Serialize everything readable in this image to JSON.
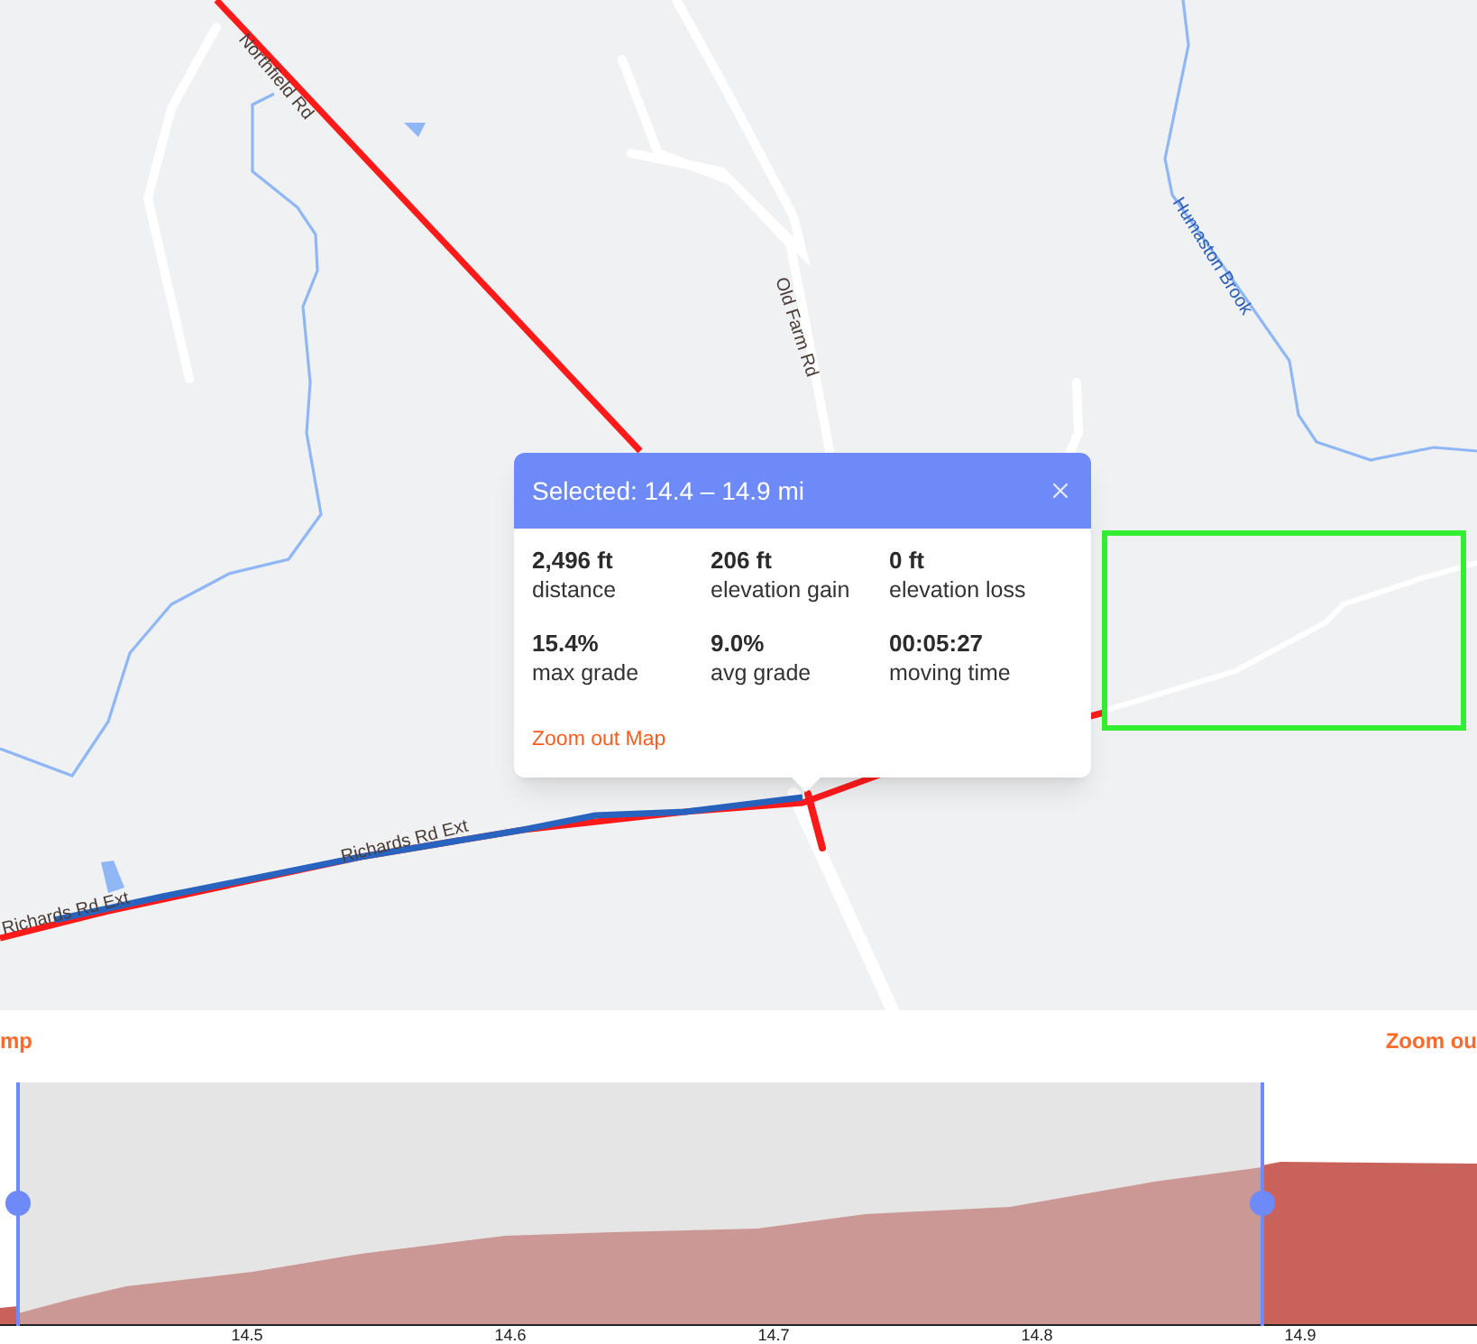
{
  "map": {
    "labels": [
      {
        "kind": "road",
        "text": "Northfield Rd"
      },
      {
        "kind": "road",
        "text": "Old Farm Rd"
      },
      {
        "kind": "water",
        "text": "Humaston Brook"
      },
      {
        "kind": "road",
        "text": "Richards Rd Ext"
      },
      {
        "kind": "road",
        "text": "Richards Rd Ext"
      }
    ]
  },
  "popup": {
    "title": "Selected: 14.4 – 14.9 mi",
    "stats": [
      {
        "value": "2,496 ft",
        "label": "distance"
      },
      {
        "value": "206 ft",
        "label": "elevation gain"
      },
      {
        "value": "0 ft",
        "label": "elevation loss"
      },
      {
        "value": "15.4%",
        "label": "max grade"
      },
      {
        "value": "9.0%",
        "label": "avg grade"
      },
      {
        "value": "00:05:27",
        "label": "moving time"
      }
    ],
    "link": "Zoom out Map"
  },
  "chart_bar": {
    "left_link": "mp",
    "right_link": "Zoom ou"
  },
  "elevation_chart": {
    "xticks": [
      "14.5",
      "14.6",
      "14.7",
      "14.8",
      "14.9"
    ]
  }
}
